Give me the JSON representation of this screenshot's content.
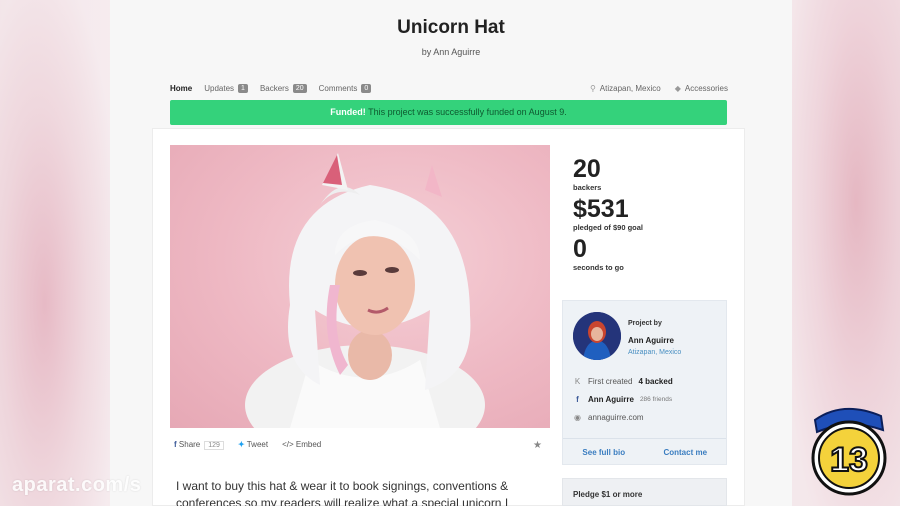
{
  "project": {
    "title": "Unicorn Hat",
    "byline": "by Ann Aguirre"
  },
  "nav": {
    "home": "Home",
    "updates": "Updates",
    "updates_count": "1",
    "backers": "Backers",
    "backers_count": "20",
    "comments": "Comments",
    "comments_count": "0",
    "location": "Atizapan, Mexico",
    "category": "Accessories"
  },
  "funded_banner": {
    "strong": "Funded!",
    "text": " This project was successfully funded on August 9."
  },
  "share": {
    "share_label": "Share",
    "share_count": "129",
    "tweet_label": "Tweet",
    "embed_label": "Embed"
  },
  "description": "I want to buy this hat & wear it to book signings, conventions & conferences so my readers will realize what a special unicorn I",
  "stats": {
    "backers_value": "20",
    "backers_label": "backers",
    "pledged_value": "$531",
    "pledged_label": "pledged of $90 goal",
    "time_value": "0",
    "time_label": "seconds to go"
  },
  "creator": {
    "label": "Project by",
    "name": "Ann Aguirre",
    "location": "Atizapan, Mexico",
    "first_created": "First created",
    "backed": "4 backed",
    "fb_name": "Ann Aguirre",
    "fb_friends": "286 friends",
    "website": "annaguirre.com",
    "see_bio": "See full bio",
    "contact": "Contact me"
  },
  "pledge": {
    "label": "Pledge $1 or more"
  },
  "overlay": {
    "watermark": "aparat.com/s",
    "episode_number": "13"
  },
  "colors": {
    "funded_green": "#34d27b",
    "link_blue": "#3a7dc0",
    "facebook_blue": "#3b5998",
    "twitter_blue": "#1da1f2",
    "photo_pink": "#eeb8c3"
  }
}
